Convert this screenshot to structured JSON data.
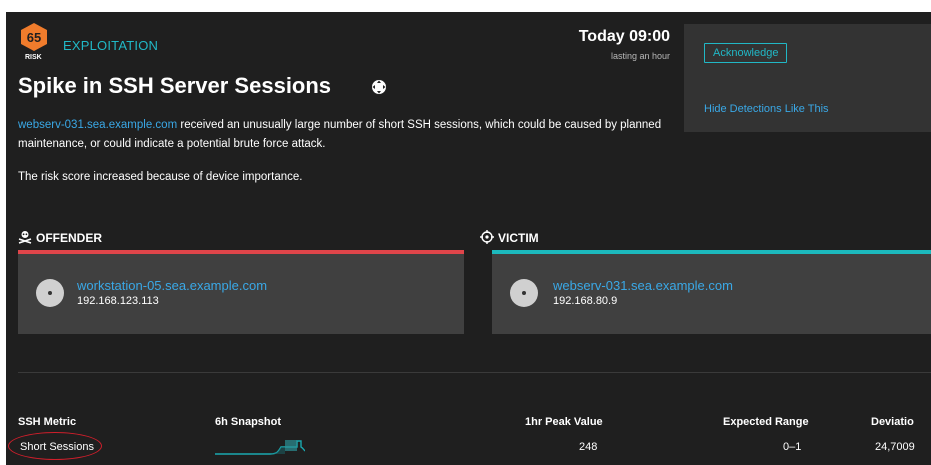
{
  "header": {
    "risk_score": "65",
    "risk_label": "RISK",
    "category": "EXPLOITATION",
    "title": "Spike in SSH Server Sessions",
    "time": "Today 09:00",
    "duration": "lasting an hour"
  },
  "actions": {
    "acknowledge_label": "Acknowledge",
    "hide_label": "Hide Detections Like This"
  },
  "description": {
    "device_link": "webserv-031.sea.example.com",
    "text_after_link": " received an unusually large number of short SSH sessions, which could be caused by planned maintenance, or could indicate a potential brute force attack.",
    "risk_note": "The risk score increased because of device importance."
  },
  "offender": {
    "heading": "OFFENDER",
    "device_name": "workstation-05.sea.example.com",
    "ip": "192.168.123.113"
  },
  "victim": {
    "heading": "VICTIM",
    "device_name": "webserv-031.sea.example.com",
    "ip": "192.168.80.9"
  },
  "metrics": {
    "headers": {
      "metric": "SSH Metric",
      "snapshot": "6h Snapshot",
      "peak": "1hr Peak Value",
      "expected": "Expected Range",
      "deviation": "Deviatio"
    },
    "row": {
      "metric": "Short Sessions",
      "peak": "248",
      "expected": "0–1",
      "deviation": "24,7009"
    }
  },
  "colors": {
    "accent_teal": "#21b8c6",
    "link_blue": "#3aa8e6",
    "offender_red": "#e0454a",
    "victim_teal": "#1cb9bd",
    "risk_orange": "#f07c2c",
    "highlight_red": "#d01f2b"
  }
}
